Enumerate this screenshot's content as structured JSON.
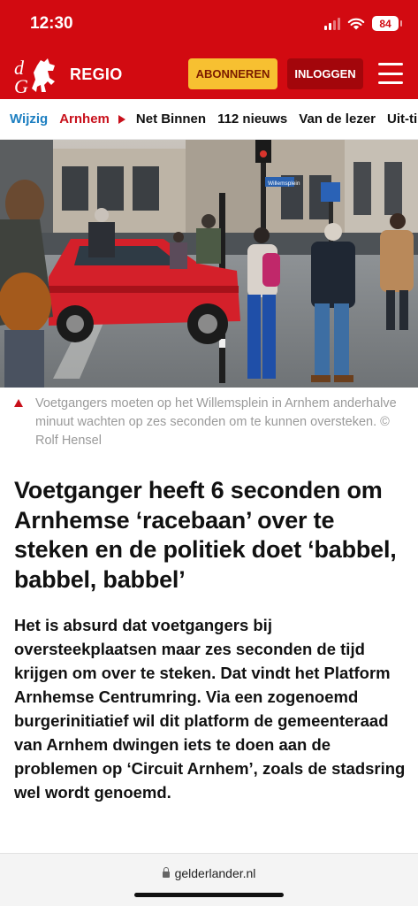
{
  "status_bar": {
    "time": "12:30",
    "battery": "84",
    "icons": [
      "cellular-signal-icon",
      "wifi-icon",
      "battery-icon"
    ]
  },
  "header": {
    "logo_icon": "dg-horse-logo-icon",
    "region": "REGIO",
    "subscribe_label": "ABONNEREN",
    "login_label": "INLOGGEN",
    "menu_icon": "hamburger-menu-icon",
    "brand_color": "#d20a11",
    "subscribe_color": "#f7c031"
  },
  "nav": {
    "edit_label": "Wijzig",
    "current": "Arnhem",
    "items": [
      "Net Binnen",
      "112 nieuws",
      "Van de lezer",
      "Uit-tip"
    ]
  },
  "article": {
    "caption": "Voetgangers moeten op het Willemsplein in Arnhem anderhalve minuut wachten op zes seconden om te kunnen oversteken. © Rolf Hensel",
    "headline": "Voetganger heeft 6 seconden om Arnhemse ‘racebaan’ over te steken en de politiek doet ‘babbel, babbel, babbel’",
    "intro": "Het is absurd dat voetgangers bij oversteekplaatsen maar zes seconden de tijd krijgen om over te steken. Dat vindt het Platform Arnhemse Centrumring. Via een zogenoemd burgerinitiatief wil dit platform de gemeenteraad van Arnhem dwingen iets te doen aan de problemen op ‘Circuit Arnhem’, zoals de stadsring wel wordt genoemd.",
    "photo_street_sign": "Willemsplein"
  },
  "browser": {
    "url": "gelderlander.nl"
  }
}
